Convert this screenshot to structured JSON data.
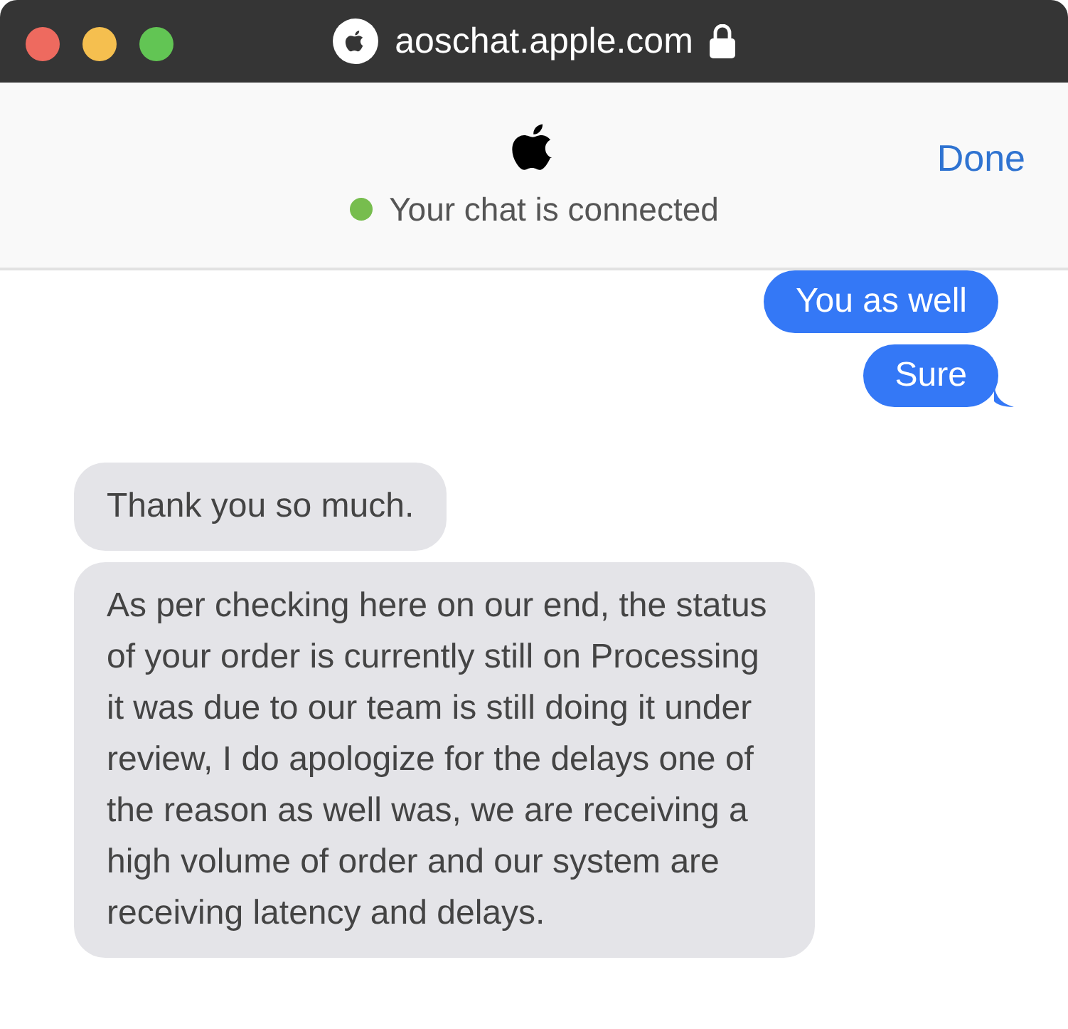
{
  "window": {
    "url": "aoschat.apple.com",
    "secure": true
  },
  "header": {
    "status": "Your chat is connected",
    "connected": true,
    "done": "Done"
  },
  "messages": [
    {
      "kind": "sent",
      "text": "You as well",
      "tail": false
    },
    {
      "kind": "sent",
      "text": "Sure",
      "tail": true
    },
    {
      "kind": "received",
      "text": "Thank you so much.",
      "tail": false
    },
    {
      "kind": "received",
      "text": "As per checking here on our end, the status of your order is currently still on Processing it was due to our team is still doing it under review, I do apologize for the delays one of the reason as well was, we are receiving a high volume of order and our system are receiving latency and delays.",
      "tail": false
    }
  ]
}
